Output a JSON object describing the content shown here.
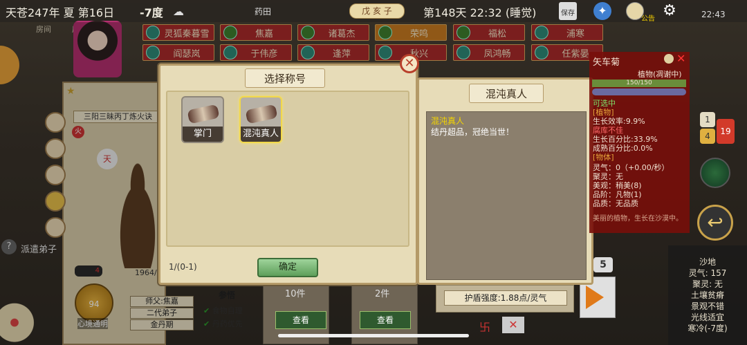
{
  "topbar": {
    "date": "天苍247年 夏 第16日",
    "temp": "-7度",
    "area": "药田",
    "season_badge": "戊 亥 子",
    "day_time": "第148天 22:32 (睡觉)",
    "save": "保存",
    "announce": "公告",
    "clock": "22:43"
  },
  "rooms": {
    "r1": "房间",
    "r2": "房间",
    "r3": "房间"
  },
  "names": [
    "灵狐秦暮雪",
    "焦嘉",
    "诸葛杰",
    "荣鸣",
    "福松",
    "浦寒",
    "阎瑟岚",
    "于伟彦",
    "逢萍",
    "秋兴",
    "凤鸿畅",
    "任紫晏"
  ],
  "left": {
    "skill": "三阳三昧丙丁炼火诀",
    "fire": "火",
    "year": "1964/",
    "count": "4",
    "dispatch": "派遣弟子",
    "level": "94",
    "level_name": "心境通明",
    "master_label": "师父:焦嘉",
    "gen": "二代弟子",
    "realm": "金丹期",
    "comprehend": "参悟",
    "food": "食物自理",
    "pill": "丹药优先"
  },
  "dialog": {
    "title": "选择称号",
    "items": [
      "掌门",
      "混沌真人"
    ],
    "page": "1/(0-1)",
    "confirm": "确定"
  },
  "detail": {
    "title": "混沌真人",
    "name": "混沌真人",
    "desc": "结丹超品，冠绝当世！"
  },
  "plant": {
    "name": "矢车菊",
    "type": "植物(凋谢中)",
    "hp": "150/150",
    "hp_fill": 1.0,
    "stats": [
      "可选中",
      "[植物]",
      "生长效率:9.9%",
      "腐库不佳",
      "生长百分比:33.9%",
      "成熟百分比:0.0%",
      "[物体]",
      "灵气：0（+0.00/秒）",
      "聚灵：无",
      "美观：稍美(8)",
      "品阶：凡物(1)",
      "品质：无品质",
      "美丽的植物，生长在沙漠中。"
    ]
  },
  "badges": {
    "b1": "1",
    "b2": "4",
    "b3": "19",
    "b4": "5"
  },
  "bottom": {
    "count1": "10件",
    "count2": "2件",
    "view1": "查看",
    "view2": "查看",
    "shield": "护盾强度:1.88点/灵气"
  },
  "terrain": {
    "lines": [
      "沙地",
      "灵气: 157",
      "聚灵: 无",
      "土壤贫瘠",
      "景观不错",
      "光线适宜",
      "寒冷(-7度)"
    ]
  }
}
